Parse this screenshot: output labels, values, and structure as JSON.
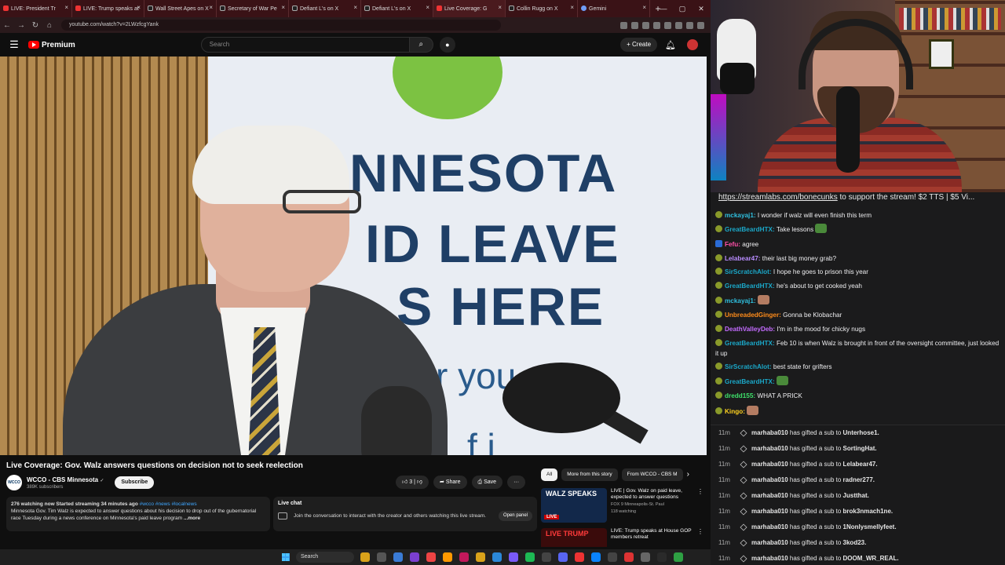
{
  "browser": {
    "tabs": [
      {
        "label": "LIVE: President Tr",
        "fav": "yt",
        "active": false
      },
      {
        "label": "LIVE: Trump speaks at",
        "fav": "yt",
        "active": false
      },
      {
        "label": "Wall Street Apes on X",
        "fav": "x",
        "active": false
      },
      {
        "label": "Secretary of War Pe",
        "fav": "x",
        "active": false
      },
      {
        "label": "Defiant L's on X",
        "fav": "x",
        "active": false
      },
      {
        "label": "Defiant L's on X",
        "fav": "x",
        "active": false
      },
      {
        "label": "Live Coverage: G",
        "fav": "yt",
        "active": true
      },
      {
        "label": "Collin Rugg on X",
        "fav": "x",
        "active": false
      },
      {
        "label": "Gemini",
        "fav": "g",
        "active": false
      }
    ],
    "url": "youtube.com/watch?v=2LWzfcgYank"
  },
  "youtube": {
    "logo_text": "Premium",
    "search_placeholder": "Search",
    "create_label": "+ Create",
    "video": {
      "banner_lines": [
        "NNESOTA",
        "ID LEAVE",
        "S HERE",
        "r you",
        "f  i"
      ]
    },
    "title": "Live Coverage: Gov. Walz answers questions on decision not to seek reelection",
    "channel": {
      "avatar_text": "WCCO",
      "name": "WCCO - CBS Minnesota",
      "verified": "✓",
      "subscribers": "389K subscribers",
      "subscribe_label": "Subscribe"
    },
    "actions": {
      "like_count": "3",
      "share_label": "Share",
      "save_label": "Save",
      "more_label": "···"
    },
    "description": {
      "meta": "276 watching now  Started streaming 34 minutes ago ",
      "tags": "#wcco #news #localnews",
      "text": "Minnesota Gov. Tim Walz is expected to answer questions about his decision to drop out of the gubernatorial race Tuesday during a news conference on Minnesota's paid leave program",
      "more": "...more"
    },
    "livechat": {
      "header": "Live chat",
      "text": "Join the conversation to interact with the creator and others watching this live stream.",
      "button": "Open panel"
    },
    "chips": [
      "All",
      "More from this story",
      "From WCCO - CBS M"
    ],
    "recommendations": [
      {
        "thumb_text": "WALZ SPEAKS",
        "live": "LIVE",
        "title": "LIVE | Gov. Walz on paid leave, expected to answer questions",
        "channel": "FOX 9 Minneapolis-St. Paul",
        "meta": "118 watching"
      },
      {
        "thumb_text": "LIVE TRUMP",
        "live": "LIVE",
        "title": "LIVE: Trump speaks at House GOP members retreat",
        "channel": "",
        "meta": ""
      }
    ]
  },
  "stream": {
    "url_prefix": "https://streamlabs.com/bonecunks",
    "url_suffix": " to support the stream! $2 TTS | $5 Vi..."
  },
  "chat": [
    {
      "user": "mckayaj1:",
      "color": "#2fbfde",
      "text": " I wonder if walz will even finish this term",
      "emote": ""
    },
    {
      "user": "GreatBeardHTX:",
      "color": "#1ba8c9",
      "text": " Take lessons ",
      "emote": "pepe"
    },
    {
      "user": "Fefu:",
      "color": "#ff4fa8",
      "text": " agree",
      "emote": "",
      "badge": "blue"
    },
    {
      "user": "Lelabear47:",
      "color": "#b98cff",
      "text": " their last big money grab?",
      "emote": ""
    },
    {
      "user": "SirScratchAlot:",
      "color": "#1ba8c9",
      "text": " I hope he goes to prison this year",
      "emote": ""
    },
    {
      "user": "GreatBeardHTX:",
      "color": "#1ba8c9",
      "text": " he's about to get cooked yeah",
      "emote": ""
    },
    {
      "user": "mckayaj1:",
      "color": "#2fbfde",
      "text": " ",
      "emote": "face"
    },
    {
      "user": "UnbreadedGinger:",
      "color": "#ff8c1a",
      "text": " Gonna be Klobachar",
      "emote": ""
    },
    {
      "user": "DeathValleyDeb:",
      "color": "#c46cff",
      "text": " I'm in the mood for chicky nugs",
      "emote": ""
    },
    {
      "user": "GreatBeardHTX:",
      "color": "#1ba8c9",
      "text": " Feb 10 is when Walz is brought in front of the oversight committee, just looked it up",
      "emote": ""
    },
    {
      "user": "SirScratchAlot:",
      "color": "#1ba8c9",
      "text": " best state for grifters",
      "emote": ""
    },
    {
      "user": "GreatBeardHTX:",
      "color": "#1ba8c9",
      "text": " ",
      "emote": "pepe"
    },
    {
      "user": "dredd155:",
      "color": "#3ee06a",
      "text": " WHAT A PRICK",
      "emote": ""
    },
    {
      "user": "Kingo:",
      "color": "#ffd21f",
      "text": " ",
      "emote": "face"
    }
  ],
  "gifts": [
    {
      "time": "11m",
      "gifter": "marhaba010",
      "mid": " has gifted a sub to ",
      "recipient": "Unterhose1."
    },
    {
      "time": "11m",
      "gifter": "marhaba010",
      "mid": " has gifted a sub to ",
      "recipient": "SortingHat."
    },
    {
      "time": "11m",
      "gifter": "marhaba010",
      "mid": " has gifted a sub to ",
      "recipient": "Lelabear47."
    },
    {
      "time": "11m",
      "gifter": "marhaba010",
      "mid": " has gifted a sub to ",
      "recipient": "radner277."
    },
    {
      "time": "11m",
      "gifter": "marhaba010",
      "mid": " has gifted a sub to ",
      "recipient": "Justthat."
    },
    {
      "time": "11m",
      "gifter": "marhaba010",
      "mid": " has gifted a sub to ",
      "recipient": "brok3nmach1ne."
    },
    {
      "time": "11m",
      "gifter": "marhaba010",
      "mid": " has gifted a sub to ",
      "recipient": "1Nonlysmellyfeet."
    },
    {
      "time": "11m",
      "gifter": "marhaba010",
      "mid": " has gifted a sub to ",
      "recipient": "3kod23."
    },
    {
      "time": "11m",
      "gifter": "marhaba010",
      "mid": " has gifted a sub to ",
      "recipient": "DOOM_WR_REAL."
    }
  ],
  "taskbar": {
    "search_label": "Search"
  }
}
